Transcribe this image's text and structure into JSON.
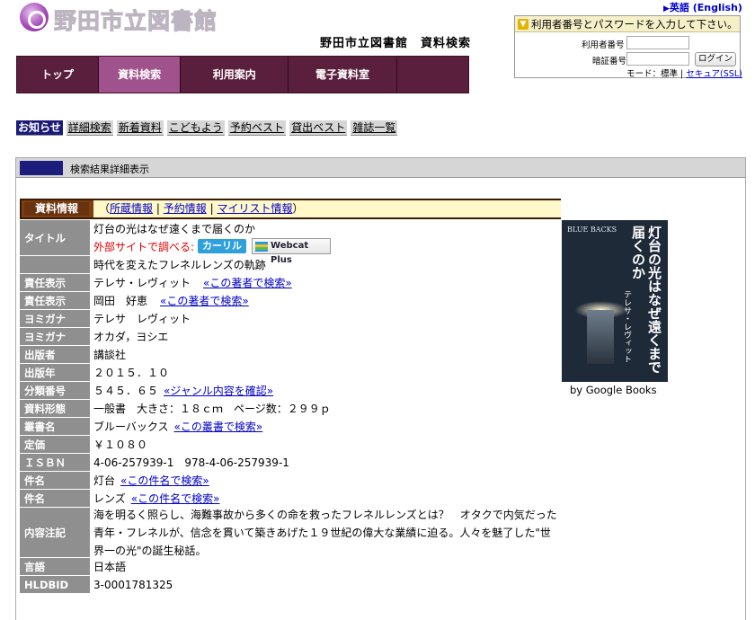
{
  "header": {
    "logo_text": "野田市立図書館",
    "site_title": "野田市立図書館　資料検索",
    "english_link": "英語 (English)"
  },
  "login": {
    "prompt": "利用者番号とパスワードを入力して下さい。",
    "id_label": "利用者番号",
    "pw_label": "暗証番号",
    "button": "ログイン",
    "mode_text": "モード：標準 | ",
    "secure_link": "セキュア(SSL)"
  },
  "nav": {
    "items": [
      "トップ",
      "資料検索",
      "利用案内",
      "電子資料室"
    ]
  },
  "tabs": [
    "お知らせ",
    "詳細検索",
    "新着資料",
    "こどもよう",
    "予約ベスト",
    "貸出ベスト",
    "雑誌一覧"
  ],
  "main": {
    "header_label": "検索結果詳細表示"
  },
  "info": {
    "header": "資料情報",
    "links": [
      "所蔵情報",
      "予約情報",
      "マイリスト情報"
    ],
    "link_open": "（",
    "link_sep": "|",
    "link_close": "）"
  },
  "detail": {
    "title_label": "タイトル",
    "title": "灯台の光はなぜ遠くまで届くのか",
    "external_label": "外部サイトで調べる:",
    "kariru": "カーリル",
    "webcat": "Webcat Plus",
    "subtitle": "時代を変えたフレネルレンズの軌跡",
    "author_label_1": "責任表示",
    "author_1": "テレサ・レヴィット",
    "author_1_link": "«この著者で検索»",
    "author_label_2": "責任表示",
    "author_2": "岡田　好恵",
    "author_2_link": "«この著者で検索»",
    "kana_label_1": "ヨミガナ",
    "kana_1": "テレサ　レヴィット",
    "kana_label_2": "ヨミガナ",
    "kana_2": "オカダ，ヨシエ",
    "publisher_label": "出版者",
    "publisher": "講談社",
    "year_label": "出版年",
    "year": "２０１５．１０",
    "class_label": "分類番号",
    "class_no": "５４５．６５",
    "class_link": "«ジャンル内容を確認»",
    "form_label": "資料形態",
    "form": "一般書　大きさ：１８ｃｍ　ページ数：２９９ｐ",
    "series_label": "叢書名",
    "series": "ブルーバックス",
    "series_link": "«この叢書で検索»",
    "price_label": "定価",
    "price": "￥１０８０",
    "isbn_label": "ＩＳＢＮ",
    "isbn": "4-06-257939-1　978-4-06-257939-1",
    "subject_label_1": "件名",
    "subject_1": "灯台",
    "subject_1_link": "«この件名で検索»",
    "subject_label_2": "件名",
    "subject_2": "レンズ",
    "subject_2_link": "«この件名で検索»",
    "notes_label": "内容注記",
    "notes": "海を明るく照らし、海難事故から多くの命を救ったフレネルレンズとは？　オタクで内気だった青年・フレネルが、信念を貫いて築きあげた１９世紀の偉大な業績に迫る。人々を魅了した\"世界一の光\"の誕生秘話。",
    "language_label": "言語",
    "language": "日本語",
    "hldbid_label": "HLDBID",
    "hldbid": "3-0001781325"
  },
  "cover": {
    "series": "BLUE BACKS",
    "title": "灯台の光はなぜ遠くまで届くのか",
    "author": "テレサ・レヴィット",
    "caption": "by Google Books"
  },
  "colors": {
    "nav_bg": "#5a1f3c",
    "nav_active": "#a0528c",
    "tab_active": "#1b1a7a",
    "label_bg": "#8f8f8f",
    "info_header": "#7b3f12",
    "link": "#0000cc"
  }
}
